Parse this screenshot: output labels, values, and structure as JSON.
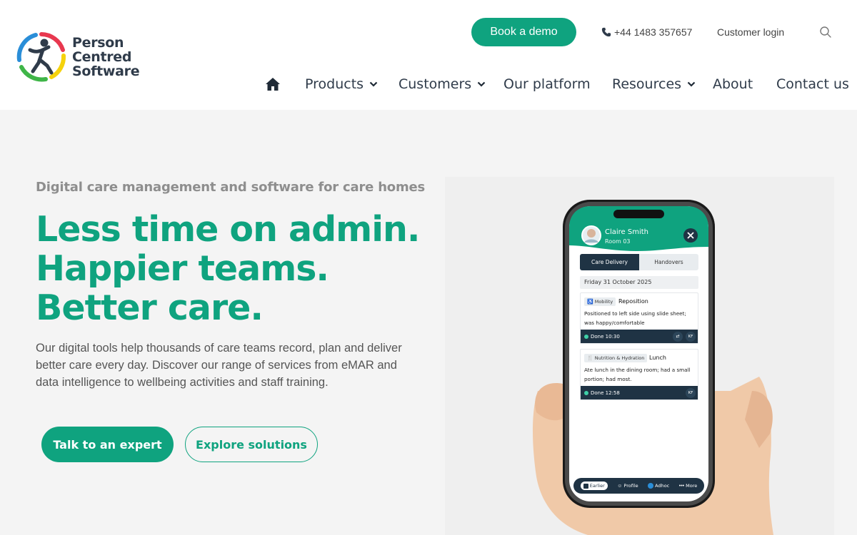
{
  "brand": {
    "logo_lines": [
      "Person",
      "Centred",
      "Software"
    ],
    "colors": {
      "green": "#0fa37f",
      "navy": "#1f3344",
      "text_dark": "#2f3b4a"
    }
  },
  "header": {
    "demo_button": "Book a demo",
    "phone": "+44 1483 357657",
    "login": "Customer login",
    "search_icon": "search-icon",
    "home_icon": "home-icon",
    "nav": [
      {
        "label": "Products",
        "has_dropdown": true
      },
      {
        "label": "Customers",
        "has_dropdown": true
      },
      {
        "label": "Our platform",
        "has_dropdown": false
      },
      {
        "label": "Resources",
        "has_dropdown": true
      },
      {
        "label": "About",
        "has_dropdown": false
      },
      {
        "label": "Contact us",
        "has_dropdown": false
      }
    ]
  },
  "hero": {
    "eyebrow": "Digital care management and software for care homes",
    "headline": [
      "Less time on admin.",
      "Happier teams.",
      "Better care."
    ],
    "lede": "Our digital tools help thousands of care teams record, plan and deliver better care every day. Discover our range of services from eMAR and data intelligence to wellbeing activities and staff training.",
    "primary_cta": "Talk to an expert",
    "secondary_cta": "Explore solutions"
  },
  "phone_app": {
    "resident_name": "Claire Smith",
    "resident_room": "Room 03",
    "tabs": [
      "Care Delivery",
      "Handovers"
    ],
    "active_tab": "Care Delivery",
    "date": "Friday 31 October 2025",
    "cards": [
      {
        "tag": "Mobility",
        "title": "Reposition",
        "note_lines": [
          "Positioned to left side using slide sheet;",
          "was happy/comfortable"
        ],
        "status": "Done 10:30",
        "initials": "KF"
      },
      {
        "tag": "Nutrition & Hydration",
        "title": "Lunch",
        "note_lines": [
          "Ate lunch in the dining room; had a small",
          "portion; had most."
        ],
        "status": "Done 12:58",
        "initials": "KF"
      }
    ],
    "bottom_nav": [
      "Earlier",
      "Profile",
      "Adhoc",
      "More"
    ]
  }
}
